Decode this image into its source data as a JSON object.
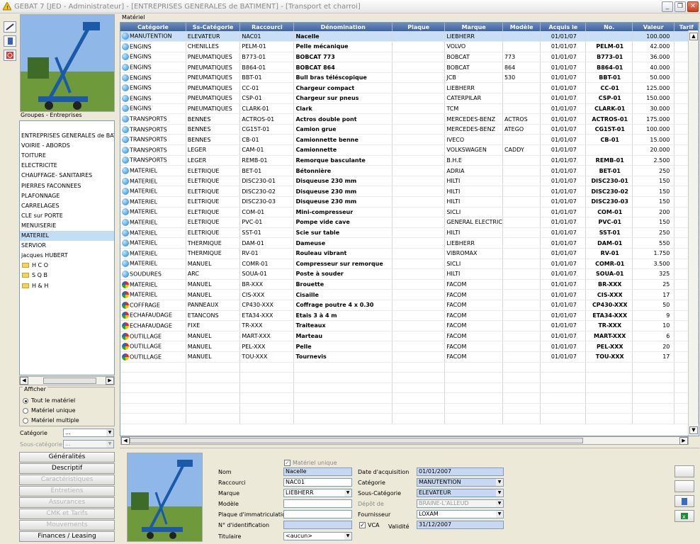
{
  "window": {
    "title": "GEBAT 7 [JED - Administrateur] - [ENTREPRISES GENERALES de BATIMENT] - [Transport et charroi]"
  },
  "sidebar": {
    "groups_label": "Groupes - Entreprises",
    "groups": [
      "",
      "ENTREPRISES GENERALES de BATIMENT",
      "VOIRIE - ABORDS",
      "TOITURE",
      "ELECTRICITE",
      "CHAUFFAGE- SANITAIRES",
      "PIERRES FACONNEES",
      "PLAFONNAGE",
      "CARRELAGES",
      "CLE sur PORTE",
      "MENUISERIE",
      "MATERIEL",
      "SERVIOR",
      "jacques HUBERT"
    ],
    "folders": [
      "H C O",
      "S Q B",
      "H & H"
    ],
    "afficher": {
      "label": "Afficher",
      "options": [
        "Tout le matériel",
        "Matériel unique",
        "Matériel multiple"
      ]
    },
    "filters": {
      "categorie_label": "Catégorie",
      "categorie_value": "...",
      "souscat_label": "Sous-catégorie",
      "souscat_value": "..."
    },
    "nav": [
      "Généralités",
      "Descriptif",
      "Caractéristiques",
      "Entretiens",
      "Assurances",
      "CMK et Tarifs",
      "Mouvements",
      "Finances / Leasing"
    ]
  },
  "grid": {
    "label": "Matériel",
    "columns": [
      "Catégorie",
      "Ss-Catégorie",
      "Raccourci",
      "Dénomination",
      "Plaque",
      "Marque",
      "Modèle",
      "Acquis le",
      "No.",
      "Valeur",
      "Tarif"
    ],
    "rows": [
      [
        "MANUTENTION",
        "ELEVATEUR",
        "NAC01",
        "Nacelle",
        "",
        "LIEBHERR",
        "",
        "01/01/07",
        "",
        "100.000"
      ],
      [
        "ENGINS",
        "CHENILLES",
        "PELM-01",
        "Pelle mécanique",
        "",
        "VOLVO",
        "",
        "01/01/07",
        "PELM-01",
        "42.000"
      ],
      [
        "ENGINS",
        "PNEUMATIQUES",
        "B773-01",
        "BOBCAT 773",
        "",
        "BOBCAT",
        "773",
        "01/01/07",
        "B773-01",
        "36.000"
      ],
      [
        "ENGINS",
        "PNEUMATIQUES",
        "B864-01",
        "BOBCAT 864",
        "",
        "BOBCAT",
        "864",
        "01/01/07",
        "B864-01",
        "40.000"
      ],
      [
        "ENGINS",
        "PNEUMATIQUES",
        "BBT-01",
        "Bull bras téléscopique",
        "",
        "JCB",
        "530",
        "01/01/07",
        "BBT-01",
        "50.000"
      ],
      [
        "ENGINS",
        "PNEUMATIQUES",
        "CC-01",
        "Chargeur compact",
        "",
        "LIEBHERR",
        "",
        "01/01/07",
        "CC-01",
        "125.000"
      ],
      [
        "ENGINS",
        "PNEUMATIQUES",
        "CSP-01",
        "Chargeur sur pneus",
        "",
        "CATERPILAR",
        "",
        "01/01/07",
        "CSP-01",
        "150.000"
      ],
      [
        "ENGINS",
        "PNEUMATIQUES",
        "CLARK-01",
        "Clark",
        "",
        "TCM",
        "",
        "01/01/07",
        "CLARK-01",
        "30.000"
      ],
      [
        "TRANSPORTS",
        "BENNES",
        "ACTROS-01",
        "Actros double pont",
        "",
        "MERCEDES-BENZ",
        "ACTROS",
        "01/01/07",
        "ACTROS-01",
        "175.000"
      ],
      [
        "TRANSPORTS",
        "BENNES",
        "CG15T-01",
        "Camion grue",
        "",
        "MERCEDES-BENZ",
        "ATEGO",
        "01/01/07",
        "CG15T-01",
        "100.000"
      ],
      [
        "TRANSPORTS",
        "BENNES",
        "CB-01",
        "Camionnette benne",
        "",
        "IVECO",
        "",
        "01/01/07",
        "CB-01",
        "15.000"
      ],
      [
        "TRANSPORTS",
        "LEGER",
        "CAM-01",
        "Camionnette",
        "",
        "VOLKSWAGEN",
        "CADDY",
        "01/01/07",
        "",
        "20.000"
      ],
      [
        "TRANSPORTS",
        "LEGER",
        "REMB-01",
        "Remorque basculante",
        "",
        "B.H.E",
        "",
        "01/01/07",
        "REMB-01",
        "2.500"
      ],
      [
        "MATERIEL",
        "ELETRIQUE",
        "BET-01",
        "Bétonnière",
        "",
        "ADRIA",
        "",
        "01/01/07",
        "BET-01",
        "250"
      ],
      [
        "MATERIEL",
        "ELETRIQUE",
        "DISC230-01",
        "Disqueuse 230 mm",
        "",
        "HILTI",
        "",
        "01/01/07",
        "DISC230-01",
        "150"
      ],
      [
        "MATERIEL",
        "ELETRIQUE",
        "DISC230-02",
        "Disqueuse 230 mm",
        "",
        "HILTI",
        "",
        "01/01/07",
        "DISC230-02",
        "150"
      ],
      [
        "MATERIEL",
        "ELETRIQUE",
        "DISC230-03",
        "Disqueuse 230 mm",
        "",
        "HILTI",
        "",
        "01/01/07",
        "DISC230-03",
        "150"
      ],
      [
        "MATERIEL",
        "ELETRIQUE",
        "COM-01",
        "Mini-compresseur",
        "",
        "SICLI",
        "",
        "01/01/07",
        "COM-01",
        "200"
      ],
      [
        "MATERIEL",
        "ELETRIQUE",
        "PVC-01",
        "Pompe vide cave",
        "",
        "GENERAL ELECTRIC",
        "",
        "01/01/07",
        "PVC-01",
        "150"
      ],
      [
        "MATERIEL",
        "ELETRIQUE",
        "SST-01",
        "Scie sur table",
        "",
        "HILTI",
        "",
        "01/01/07",
        "SST-01",
        "250"
      ],
      [
        "MATERIEL",
        "THERMIQUE",
        "DAM-01",
        "Dameuse",
        "",
        "LIEBHERR",
        "",
        "01/01/07",
        "DAM-01",
        "550"
      ],
      [
        "MATERIEL",
        "THERMIQUE",
        "RV-01",
        "Rouleau vibrant",
        "",
        "VIBROMAX",
        "",
        "01/01/07",
        "RV-01",
        "1.750"
      ],
      [
        "MATERIEL",
        "MANUEL",
        "COMR-01",
        "Compresseur sur remorque",
        "",
        "SICLI",
        "",
        "01/01/07",
        "COMR-01",
        "3.500"
      ],
      [
        "SOUDURES",
        "ARC",
        "SOUA-01",
        "Poste à souder",
        "",
        "HILTI",
        "",
        "01/01/07",
        "SOUA-01",
        "325"
      ],
      [
        "MATERIEL",
        "MANUEL",
        "BR-XXX",
        "Brouette",
        "",
        "FACOM",
        "",
        "01/01/07",
        "BR-XXX",
        "25"
      ],
      [
        "MATERIEL",
        "MANUEL",
        "CIS-XXX",
        "Cisaille",
        "",
        "FACOM",
        "",
        "01/01/07",
        "CIS-XXX",
        "17"
      ],
      [
        "COFFRAGE",
        "PANNEAUX",
        "CP430-XXX",
        "Coffrage poutre 4 x 0.30",
        "",
        "FACOM",
        "",
        "01/01/07",
        "CP430-XXX",
        "50"
      ],
      [
        "ECHAFAUDAGE",
        "ETANCONS",
        "ETA34-XXX",
        "Etais 3 à 4 m",
        "",
        "FACOM",
        "",
        "01/01/07",
        "ETA34-XXX",
        "9"
      ],
      [
        "ECHAFAUDAGE",
        "FIXE",
        "TR-XXX",
        "Traiteaux",
        "",
        "FACOM",
        "",
        "01/01/07",
        "TR-XXX",
        "10"
      ],
      [
        "OUTILLAGE",
        "MANUEL",
        "MART-XXX",
        "Marteau",
        "",
        "FACOM",
        "",
        "01/01/07",
        "MART-XXX",
        "6"
      ],
      [
        "OUTILLAGE",
        "MANUEL",
        "PEL-XXX",
        "Pelle",
        "",
        "FACOM",
        "",
        "01/01/07",
        "PEL-XXX",
        "20"
      ],
      [
        "OUTILLAGE",
        "MANUEL",
        "TOU-XXX",
        "Tournevis",
        "",
        "FACOM",
        "",
        "01/01/07",
        "TOU-XXX",
        "17"
      ]
    ],
    "multi_from_row": 24
  },
  "detail": {
    "materiel_unique_label": "Matériel unique",
    "nom_label": "Nom",
    "nom": "Nacelle",
    "raccourci_label": "Raccourci",
    "raccourci": "NAC01",
    "marque_label": "Marque",
    "marque": "LIEBHERR",
    "modele_label": "Modèle",
    "modele": "",
    "plaque_label": "Plaque d'immatriculation",
    "plaque": "",
    "nid_label": "N° d'identification",
    "nid": "",
    "titulaire_label": "Titulaire",
    "titulaire": "<aucun>",
    "date_label": "Date d'acquisition",
    "date": "01/01/2007",
    "categorie_label": "Catégorie",
    "categorie": "MANUTENTION",
    "souscat_label": "Sous-Catégorie",
    "souscat": "ELEVATEUR",
    "depot_label": "Dépôt de",
    "depot": "BRAINE-L'ALLEUD",
    "fournisseur_label": "Fournisseur",
    "fournisseur": "LOXAM",
    "vca_label": "VCA",
    "validite_label": "Validité",
    "validite": "31/12/2007"
  }
}
